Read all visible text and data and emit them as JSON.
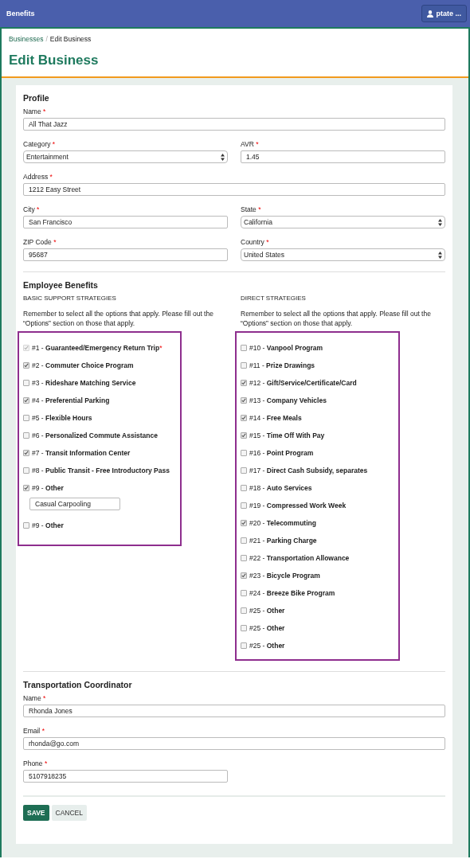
{
  "topbar": {
    "brand": "Benefits",
    "user": "ptate ..."
  },
  "breadcrumb": [
    {
      "label": "Businesses",
      "current": false
    },
    {
      "label": "Edit Business",
      "current": true
    }
  ],
  "breadcrumb_separator": "/",
  "title": "Edit Business",
  "profile": {
    "heading": "Profile",
    "rows": [
      [
        {
          "label": "Name",
          "required_mark": "*",
          "value": "All That Jazz",
          "kind": "wide-text"
        }
      ],
      [
        {
          "label": "Category",
          "required_mark": "*",
          "value": "Entertainment",
          "kind": "select"
        },
        {
          "label": "AVR",
          "required_mark": "*",
          "value": "1.45",
          "kind": "text"
        }
      ],
      [
        {
          "label": "Address",
          "required_mark": "*",
          "value": "1212 Easy Street",
          "kind": "wide-text"
        }
      ],
      [
        {
          "label": "City",
          "required_mark": "*",
          "value": "San Francisco",
          "kind": "text"
        },
        {
          "label": "State",
          "required_mark": "*",
          "value": "California",
          "kind": "select"
        }
      ],
      [
        {
          "label": "ZIP Code",
          "required_mark": "*",
          "value": "95687",
          "kind": "text"
        },
        {
          "label": "Country",
          "required_mark": "*",
          "value": "United States",
          "kind": "select"
        }
      ]
    ]
  },
  "benefits": {
    "heading": "Employee Benefits",
    "groups": [
      {
        "title": "BASIC SUPPORT STRATEGIES",
        "note": "Remember to select all the options that apply. Please fill out the “Options” section on those that apply.",
        "items": [
          {
            "label": "#1 - **Guaranteed/Emergency Return Trip**",
            "checked": true,
            "disabled": true,
            "required_mark": "*"
          },
          {
            "label": "#2 - **Commuter Choice Program**",
            "checked": true,
            "disabled": false
          },
          {
            "label": "#3 - **Rideshare Matching Service**",
            "checked": false,
            "disabled": false
          },
          {
            "label": "#4 - **Preferential Parking**",
            "checked": true,
            "disabled": false
          },
          {
            "label": "#5 - **Flexible Hours**",
            "checked": false,
            "disabled": false
          },
          {
            "label": "#6 - **Personalized Commute Assistance**",
            "checked": false,
            "disabled": false
          },
          {
            "label": "#7 - **Transit Information Center**",
            "checked": true,
            "disabled": false
          },
          {
            "label": "#8 - **Public Transit - Free Introductory Pass**",
            "checked": false,
            "disabled": false
          },
          {
            "label": "#9 - **Other**",
            "checked": true,
            "disabled": false,
            "option": "Casual Carpooling"
          },
          {
            "label": "#9 - **Other**",
            "checked": false,
            "disabled": false
          }
        ]
      },
      {
        "title": "DIRECT STRATEGIES",
        "note": "Remember to select all the options that apply. Please fill out the “Options” section on those that apply.",
        "items": [
          {
            "label": "#10 - **Vanpool Program**",
            "checked": false,
            "disabled": false
          },
          {
            "label": "#11 - **Prize Drawings**",
            "checked": false,
            "disabled": false
          },
          {
            "label": "#12 - **Gift/Service/Certificate/Card**",
            "checked": true,
            "disabled": false
          },
          {
            "label": "#13 - **Company Vehicles**",
            "checked": true,
            "disabled": false
          },
          {
            "label": "#14 - **Free Meals**",
            "checked": true,
            "disabled": false
          },
          {
            "label": "#15 - **Time Off With Pay**",
            "checked": true,
            "disabled": false
          },
          {
            "label": "#16 - **Point Program**",
            "checked": false,
            "disabled": false
          },
          {
            "label": "#17 - **Direct Cash Subsidy, separates**",
            "checked": false,
            "disabled": false
          },
          {
            "label": "#18 - **Auto Services**",
            "checked": false,
            "disabled": false
          },
          {
            "label": "#19 - **Compressed Work Week**",
            "checked": false,
            "disabled": false
          },
          {
            "label": "#20 - **Telecommuting**",
            "checked": true,
            "disabled": false
          },
          {
            "label": "#21 - **Parking Charge**",
            "checked": false,
            "disabled": false
          },
          {
            "label": "#22 - **Transportation Allowance**",
            "checked": false,
            "disabled": false
          },
          {
            "label": "#23 - **Bicycle Program**",
            "checked": true,
            "disabled": false
          },
          {
            "label": "#24 - **Breeze Bike Program**",
            "checked": false,
            "disabled": false
          },
          {
            "label": "#25 - **Other**",
            "checked": false,
            "disabled": false
          },
          {
            "label": "#25 - **Other**",
            "checked": false,
            "disabled": false
          },
          {
            "label": "#25 - **Other**",
            "checked": false,
            "disabled": false
          }
        ]
      }
    ]
  },
  "coordinator": {
    "heading": "Transportation Coordinator",
    "rows": [
      [
        {
          "label": "Name",
          "required_mark": "*",
          "value": "Rhonda Jones",
          "kind": "wide-text"
        }
      ],
      [
        {
          "label": "Email",
          "required_mark": "*",
          "value": "rhonda@go.com",
          "kind": "wide-text"
        }
      ],
      [
        {
          "label": "Phone",
          "required_mark": "*",
          "value": "5107918235",
          "kind": "text"
        }
      ]
    ]
  },
  "buttons": [
    {
      "label": "SAVE",
      "kind": "primary"
    },
    {
      "label": "CANCEL",
      "kind": "secondary"
    }
  ]
}
